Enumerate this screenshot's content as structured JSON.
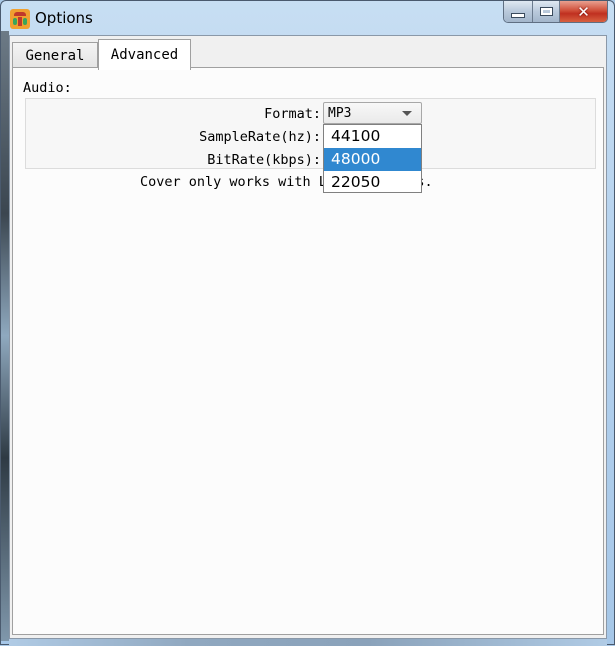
{
  "window": {
    "title": "Options",
    "controls": {
      "minimize": "minimize",
      "maximize": "maximize",
      "close": "close"
    }
  },
  "tabs": [
    {
      "label": "General",
      "active": false
    },
    {
      "label": "Advanced",
      "active": true
    }
  ],
  "advanced": {
    "section_label": "Audio:",
    "format_label": "Format:",
    "format_value": "MP3",
    "samplerate_label": "SampleRate(hz):",
    "bitrate_label": "BitRate(kbps):",
    "cover_note": "Cover only works with L       files.",
    "samplerate_dropdown": {
      "options": [
        "44100",
        "48000",
        "22050"
      ],
      "highlighted": "48000"
    }
  },
  "colors": {
    "highlight": "#3088d0",
    "close_button": "#c8402a"
  }
}
